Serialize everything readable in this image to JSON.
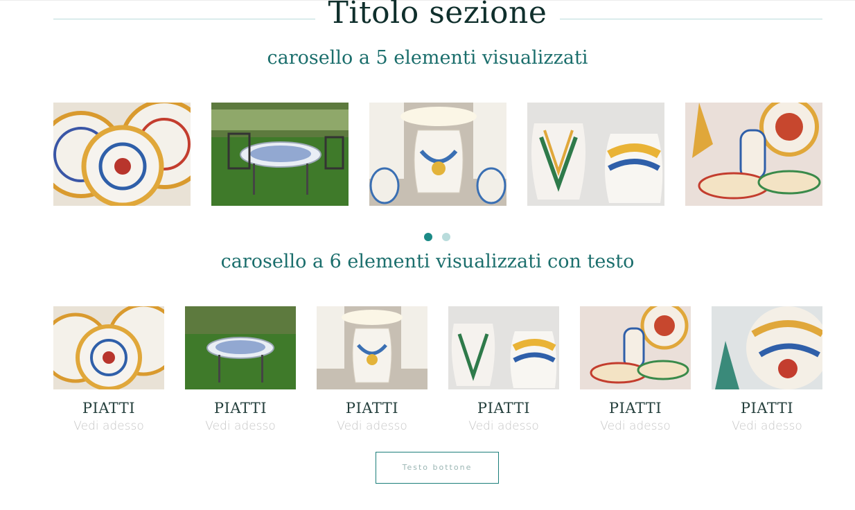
{
  "section": {
    "title": "Titolo sezione",
    "subtitle_5": "carosello a 5 elementi visualizzati",
    "subtitle_6": "carosello a 6 elementi visualizzati con testo"
  },
  "carousel5": {
    "items": [
      {
        "image": "piatti-plates"
      },
      {
        "image": "garden-table"
      },
      {
        "image": "ceramic-lamp"
      },
      {
        "image": "ceramic-vases"
      },
      {
        "image": "decorated-ceramics"
      }
    ],
    "dots": {
      "count": 2,
      "active": 1
    }
  },
  "carousel6": {
    "items": [
      {
        "image": "piatti-plates",
        "title": "PIATTI",
        "link": "Vedi adesso"
      },
      {
        "image": "garden-table",
        "title": "PIATTI",
        "link": "Vedi adesso"
      },
      {
        "image": "ceramic-lamp",
        "title": "PIATTI",
        "link": "Vedi adesso"
      },
      {
        "image": "ceramic-vases",
        "title": "PIATTI",
        "link": "Vedi adesso"
      },
      {
        "image": "decorated-ceramics",
        "title": "PIATTI",
        "link": "Vedi adesso"
      },
      {
        "image": "ceramic-vase-closeup",
        "title": "PIATTI",
        "link": "Vedi adesso"
      }
    ]
  },
  "button": {
    "label": "Testo bottone"
  },
  "colors": {
    "accent": "#1b8a86",
    "title": "#0f2f2c",
    "subtitle": "#1b6e6c",
    "rule": "#b9dcdc"
  }
}
